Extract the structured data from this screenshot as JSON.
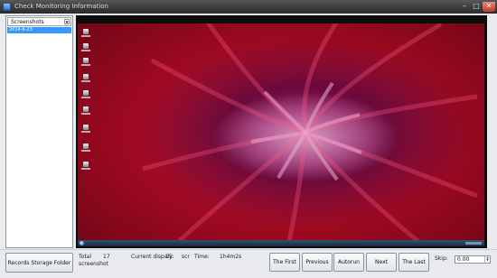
{
  "window": {
    "title": "Check Monitoring Information",
    "min_glyph": "–",
    "max_glyph": "□",
    "close_glyph": "✕"
  },
  "sidebar": {
    "dropdown_value": "Screenshots",
    "dropdown_arrow": "▼",
    "items": [
      {
        "label": "2014-6-23",
        "selected": true
      }
    ]
  },
  "viewer": {
    "desktop_icon_count": 9,
    "wallpaper_colors": [
      "#d31534",
      "#9f1c68",
      "#d5a0c6"
    ]
  },
  "controls": {
    "records_storage_folder": "Records Storage Folder",
    "total_label": "Total",
    "total_value": "17",
    "screenshot_label": "screenshot",
    "current_display_label": "Current dispaly:",
    "current_display_value": "15",
    "current_display_unit": "scr",
    "time_label": "Time:",
    "time_value": "1h4m2s",
    "first_button": "The First",
    "previous_button": "Previous",
    "autorun_button": "Autorun",
    "next_button": "Next",
    "last_button": "The Last",
    "skip_label": "Skip:",
    "skip_value": "0.00",
    "skip_spin_up": "▲",
    "skip_spin_down": "▼"
  }
}
